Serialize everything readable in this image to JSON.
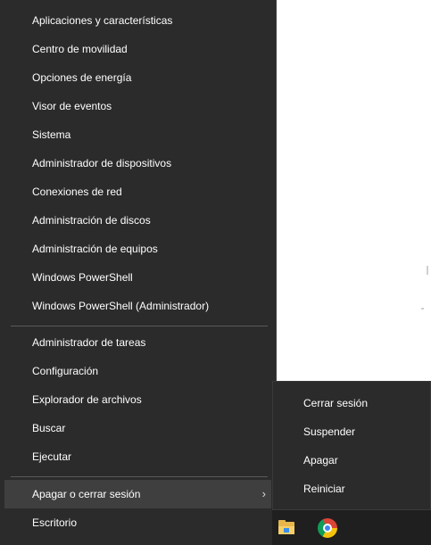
{
  "menu": {
    "group1": [
      {
        "label": "Aplicaciones y características",
        "name": "menu-item-aplicaciones"
      },
      {
        "label": "Centro de movilidad",
        "name": "menu-item-centro-movilidad"
      },
      {
        "label": "Opciones de energía",
        "name": "menu-item-opciones-energia"
      },
      {
        "label": "Visor de eventos",
        "name": "menu-item-visor-eventos"
      },
      {
        "label": "Sistema",
        "name": "menu-item-sistema"
      },
      {
        "label": "Administrador de dispositivos",
        "name": "menu-item-admin-dispositivos"
      },
      {
        "label": "Conexiones de red",
        "name": "menu-item-conexiones-red"
      },
      {
        "label": "Administración de discos",
        "name": "menu-item-admin-discos"
      },
      {
        "label": "Administración de equipos",
        "name": "menu-item-admin-equipos"
      },
      {
        "label": "Windows PowerShell",
        "name": "menu-item-powershell"
      },
      {
        "label": "Windows PowerShell (Administrador)",
        "name": "menu-item-powershell-admin"
      }
    ],
    "group2": [
      {
        "label": "Administrador de tareas",
        "name": "menu-item-admin-tareas"
      },
      {
        "label": "Configuración",
        "name": "menu-item-configuracion"
      },
      {
        "label": "Explorador de archivos",
        "name": "menu-item-explorador"
      },
      {
        "label": "Buscar",
        "name": "menu-item-buscar"
      },
      {
        "label": "Ejecutar",
        "name": "menu-item-ejecutar"
      }
    ],
    "group3": [
      {
        "label": "Apagar o cerrar sesión",
        "name": "menu-item-apagar-cerrar-sesion",
        "has_submenu": true,
        "active": true
      },
      {
        "label": "Escritorio",
        "name": "menu-item-escritorio"
      }
    ],
    "chevron": "›"
  },
  "submenu": {
    "items": [
      {
        "label": "Cerrar sesión",
        "name": "submenu-item-cerrar-sesion"
      },
      {
        "label": "Suspender",
        "name": "submenu-item-suspender"
      },
      {
        "label": "Apagar",
        "name": "submenu-item-apagar"
      },
      {
        "label": "Reiniciar",
        "name": "submenu-item-reiniciar"
      }
    ]
  },
  "taskbar": {
    "icons": [
      "folder-icon",
      "chrome-icon"
    ]
  },
  "colors": {
    "menu_bg": "#2b2b2b",
    "active_bg": "#3f3f3f",
    "text": "#ffffff",
    "separator": "#5a5a5a"
  }
}
